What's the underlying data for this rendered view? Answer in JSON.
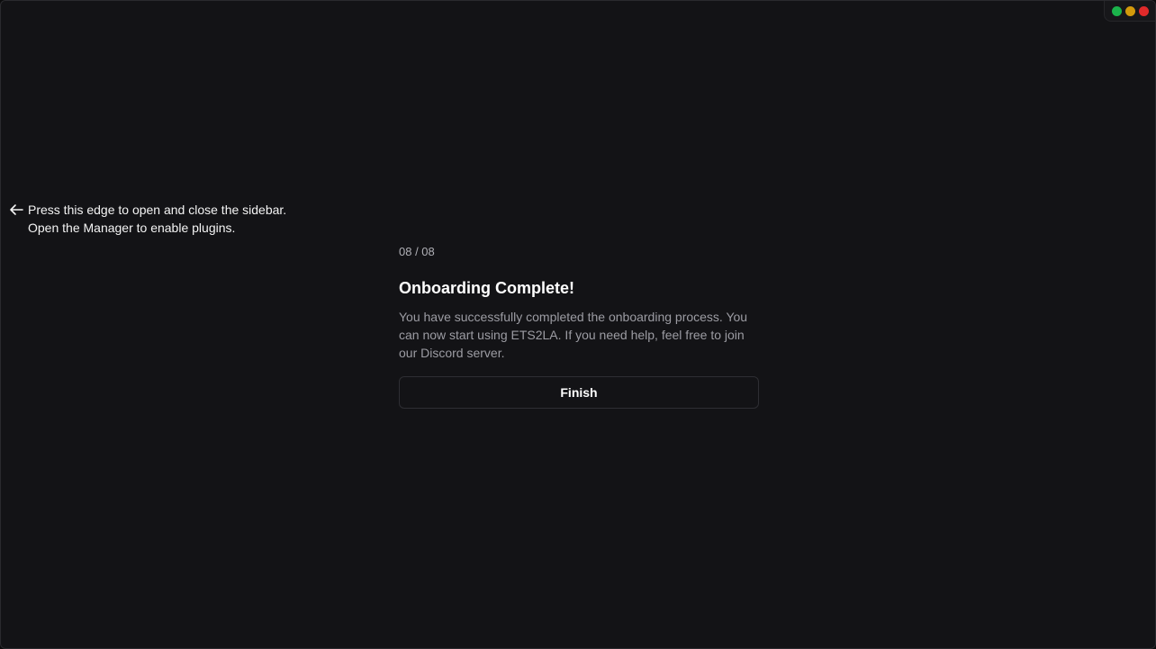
{
  "window_controls": {
    "buttons": [
      {
        "name": "green",
        "color": "#1bb34b"
      },
      {
        "name": "yellow",
        "color": "#d39a0b"
      },
      {
        "name": "red",
        "color": "#e02a2a"
      }
    ]
  },
  "sidebar_hint": {
    "arrow_icon": "arrow-left-icon",
    "line1": "Press this edge to open and close the sidebar.",
    "line2": "Open the Manager to enable plugins."
  },
  "onboarding": {
    "step": "08 / 08",
    "title": "Onboarding Complete!",
    "description": "You have successfully completed the onboarding process. You can now start using ETS2LA. If you need help, feel free to join our Discord server.",
    "finish_label": "Finish"
  }
}
